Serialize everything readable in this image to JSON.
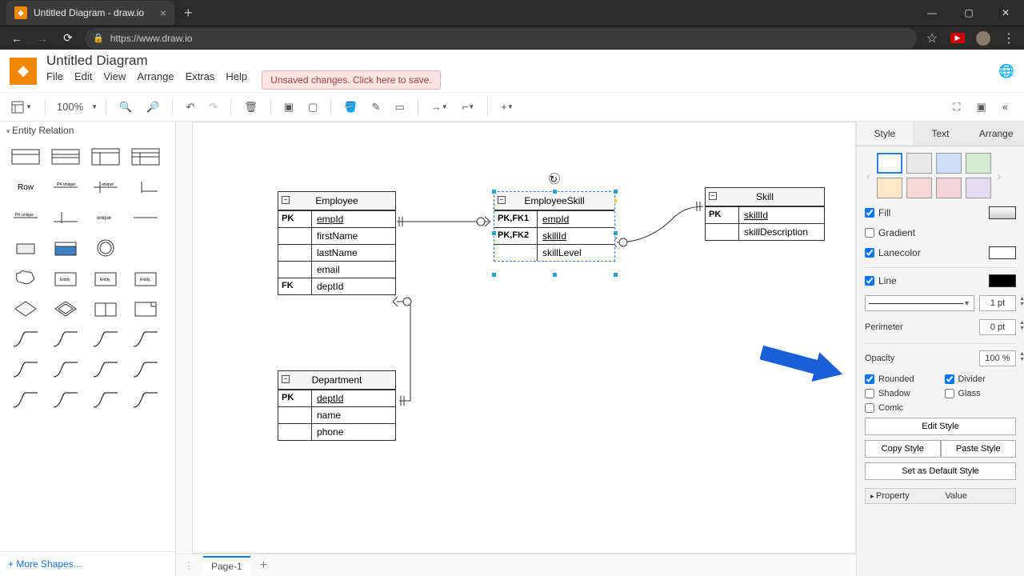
{
  "browser": {
    "tab_title": "Untitled Diagram - draw.io",
    "url": "https://www.draw.io"
  },
  "window": {
    "min": "—",
    "max": "▢",
    "close": "✕"
  },
  "header": {
    "doc_title": "Untitled Diagram",
    "menu": {
      "file": "File",
      "edit": "Edit",
      "view": "View",
      "arrange": "Arrange",
      "extras": "Extras",
      "help": "Help"
    },
    "save_alert": "Unsaved changes. Click here to save."
  },
  "toolbar": {
    "zoom": "100%"
  },
  "sidebar": {
    "section": "Entity Relation",
    "row_label": "Row",
    "more_shapes": "More Shapes..."
  },
  "canvas": {
    "employee": {
      "title": "Employee",
      "rows": [
        {
          "k": "PK",
          "v": "empId",
          "u": true
        },
        {
          "k": "",
          "v": "firstName"
        },
        {
          "k": "",
          "v": "lastName"
        },
        {
          "k": "",
          "v": "email"
        },
        {
          "k": "FK",
          "v": "deptId"
        }
      ]
    },
    "employee_skill": {
      "title": "EmployeeSkill",
      "rows": [
        {
          "k": "PK,FK1",
          "v": "empId",
          "u": true
        },
        {
          "k": "PK,FK2",
          "v": "skillId",
          "u": true
        },
        {
          "k": "",
          "v": "skillLevel"
        }
      ]
    },
    "skill": {
      "title": "Skill",
      "rows": [
        {
          "k": "PK",
          "v": "skillId",
          "u": true
        },
        {
          "k": "",
          "v": "skillDescription"
        }
      ]
    },
    "department": {
      "title": "Department",
      "rows": [
        {
          "k": "PK",
          "v": "deptId",
          "u": true
        },
        {
          "k": "",
          "v": "name"
        },
        {
          "k": "",
          "v": "phone"
        }
      ]
    }
  },
  "pages": {
    "page1": "Page-1"
  },
  "format": {
    "tabs": {
      "style": "Style",
      "text": "Text",
      "arrange": "Arrange"
    },
    "swatches": [
      "#ffffff",
      "#e8e8e8",
      "#cde0f5",
      "#d4ecd4",
      "#fce6c8",
      "#f7d7d7",
      "#f5d5da",
      "#e3dbf2"
    ],
    "fill": "Fill",
    "gradient": "Gradient",
    "lanecolor": "Lanecolor",
    "line": "Line",
    "line_width": "1 pt",
    "perimeter": "Perimeter",
    "perimeter_val": "0 pt",
    "opacity": "Opacity",
    "opacity_val": "100 %",
    "rounded": "Rounded",
    "divider": "Divider",
    "shadow": "Shadow",
    "glass": "Glass",
    "comic": "Comic",
    "edit_style": "Edit Style",
    "copy_style": "Copy Style",
    "paste_style": "Paste Style",
    "default_style": "Set as Default Style",
    "property": "Property",
    "value": "Value"
  }
}
